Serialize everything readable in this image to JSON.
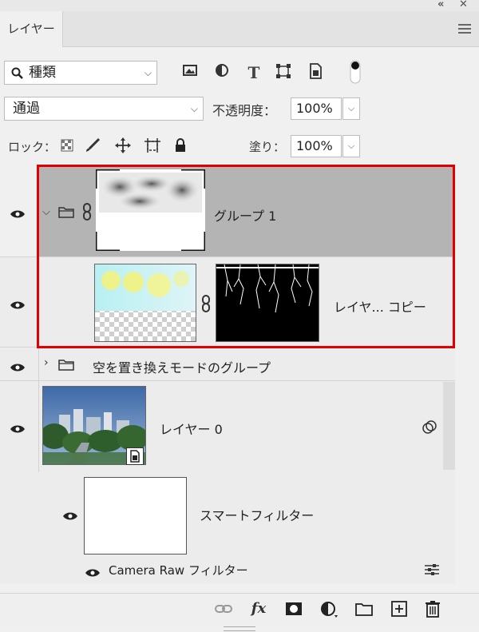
{
  "panel": {
    "tab_label": "レイヤー",
    "collapse_glyph": "«",
    "close_glyph": "✕"
  },
  "filter": {
    "kind_label": "種類",
    "icons": [
      "image-filter-icon",
      "adjustment-filter-icon",
      "type-filter-icon",
      "shape-filter-icon",
      "smart-object-filter-icon",
      "filter-toggle-icon"
    ]
  },
  "blend": {
    "mode": "通過",
    "opacity_label": "不透明度：",
    "opacity_value": "100%"
  },
  "lock": {
    "label": "ロック：",
    "fill_label": "塗り：",
    "fill_value": "100%"
  },
  "layers": [
    {
      "name": "グループ 1",
      "type": "group",
      "expanded": true,
      "selected": true
    },
    {
      "name": "レイヤ... コピー",
      "type": "layer-with-mask"
    },
    {
      "name": "空を置き換えモードのグループ",
      "type": "group",
      "expanded": false
    },
    {
      "name": "レイヤー 0",
      "type": "smart-object"
    },
    {
      "name": "スマートフィルター",
      "type": "smart-filters"
    },
    {
      "name": "Camera Raw フィルター",
      "type": "filter"
    }
  ],
  "colors": {
    "selected_row": "#b4b4b4",
    "highlight_frame": "#e00000",
    "panel_bg": "#f0f0f0"
  },
  "bottom_icons": [
    "link-layers-icon",
    "fx-icon",
    "add-mask-icon",
    "adjustment-layer-icon",
    "new-group-icon",
    "new-layer-icon",
    "delete-icon"
  ],
  "bottom_fx_label": "fx"
}
